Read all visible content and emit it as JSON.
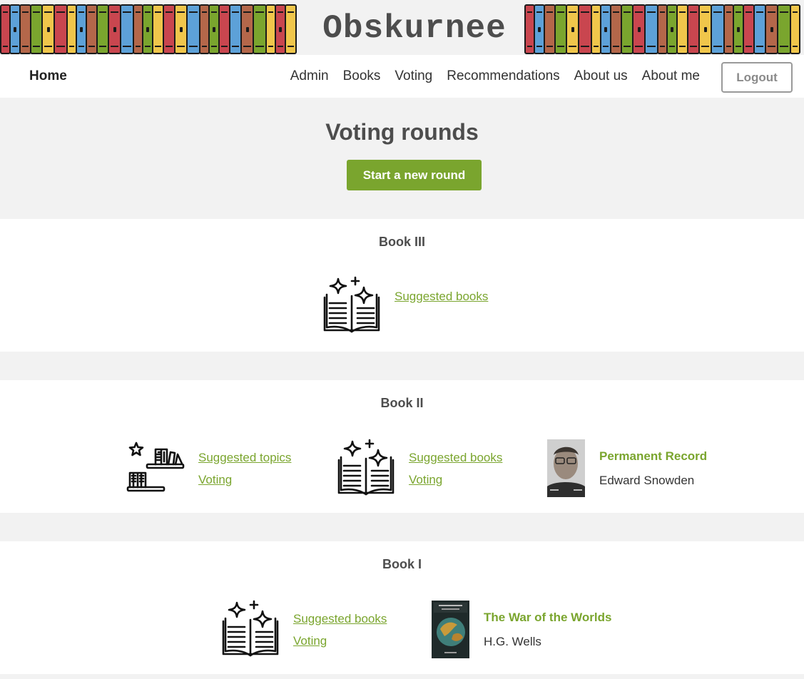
{
  "site": {
    "title": "Obskurnee"
  },
  "nav": {
    "home": "Home",
    "links": [
      "Admin",
      "Books",
      "Voting",
      "Recommendations",
      "About us",
      "About me"
    ],
    "logout": "Logout"
  },
  "hero": {
    "title": "Voting rounds",
    "start_button": "Start a new round"
  },
  "rounds": [
    {
      "title": "Book III",
      "items": [
        {
          "icon": "open-book-sparkles-icon",
          "links": [
            "Suggested books"
          ]
        }
      ]
    },
    {
      "title": "Book II",
      "items": [
        {
          "icon": "bookshelf-icon",
          "links": [
            "Suggested topics",
            "Voting"
          ]
        },
        {
          "icon": "open-book-sparkles-icon",
          "links": [
            "Suggested books",
            "Voting"
          ]
        },
        {
          "cover": "portrait-cover",
          "book_title": "Permanent Record",
          "author": "Edward Snowden"
        }
      ]
    },
    {
      "title": "Book I",
      "items": [
        {
          "icon": "open-book-sparkles-icon",
          "links": [
            "Suggested books",
            "Voting"
          ]
        },
        {
          "cover": "globe-cover",
          "book_title": "The War of the Worlds",
          "author": "H.G. Wells"
        }
      ]
    }
  ],
  "colors": {
    "accent": "#7aa52e",
    "background": "#f2f2f2",
    "text": "#454545"
  }
}
